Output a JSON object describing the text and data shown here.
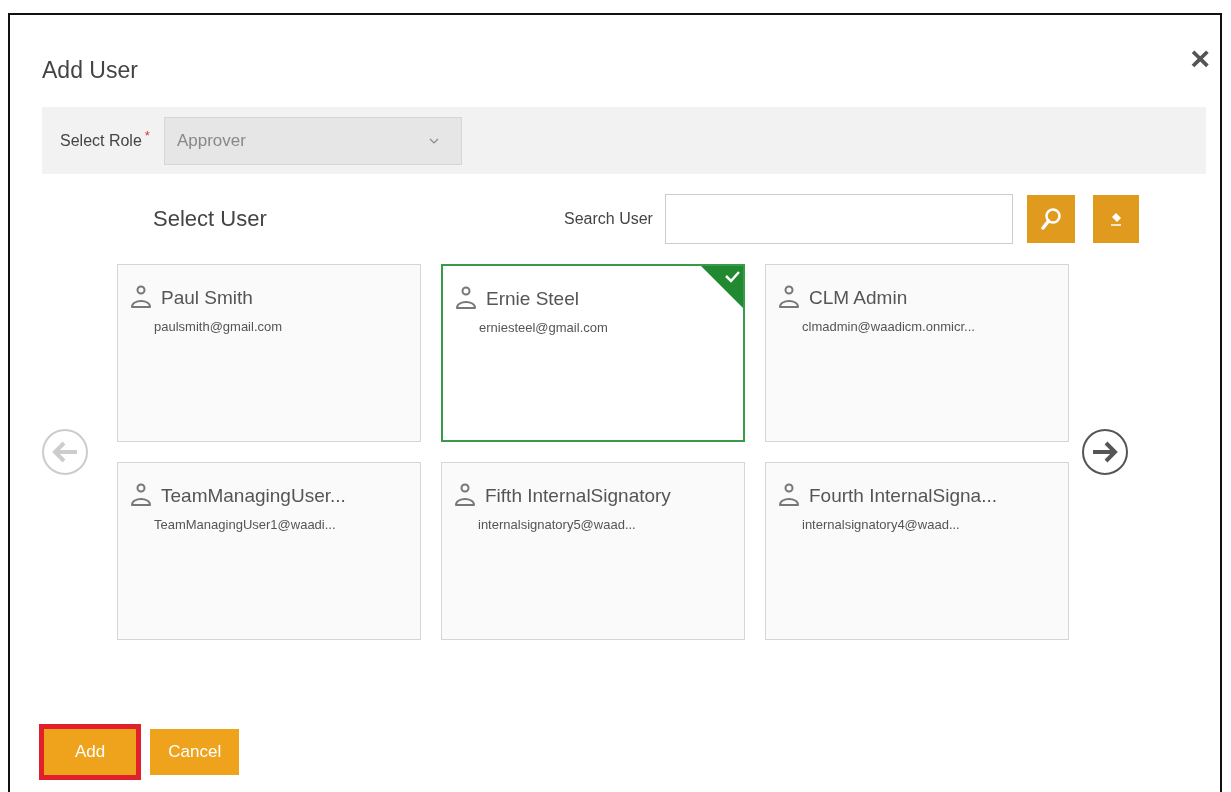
{
  "dialog": {
    "title": "Add User",
    "close": "×"
  },
  "role": {
    "label": "Select Role",
    "required_mark": "*",
    "value": "Approver"
  },
  "select_user": {
    "heading": "Select User",
    "search_label": "Search User"
  },
  "nav": [
    {
      "kind": "prev",
      "disabled": true
    },
    {
      "kind": "next",
      "disabled": false
    }
  ],
  "users": [
    {
      "name": "Paul Smith",
      "email": "paulsmith@gmail.com",
      "selected": false
    },
    {
      "name": "Ernie Steel",
      "email": "erniesteel@gmail.com",
      "selected": true
    },
    {
      "name": "CLM Admin",
      "email": "clmadmin@waadicm.onmicr...",
      "selected": false
    },
    {
      "name": "TeamManagingUser...",
      "email": "TeamManagingUser1@waadi...",
      "selected": false
    },
    {
      "name": "Fifth InternalSignatory",
      "email": "internalsignatory5@waad...",
      "selected": false
    },
    {
      "name": "Fourth InternalSigna...",
      "email": "internalsignatory4@waad...",
      "selected": false
    }
  ],
  "buttons": [
    {
      "label": "Add",
      "highlighted": true
    },
    {
      "label": "Cancel",
      "highlighted": false
    }
  ]
}
